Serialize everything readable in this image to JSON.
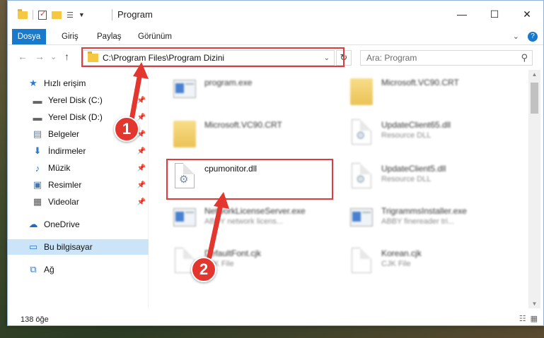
{
  "window": {
    "title": "Program",
    "controls": {
      "minimize": "—",
      "maximize": "☐",
      "close": "✕"
    }
  },
  "ribbon": {
    "tabs": [
      "Dosya",
      "Giriş",
      "Paylaş",
      "Görünüm"
    ],
    "accent_color": "#1979ca"
  },
  "navbar": {
    "back": "←",
    "forward": "→",
    "recent": "⌄",
    "up": "↑",
    "address": "C:\\Program Files\\Program Dizini",
    "search_placeholder": "Ara: Program"
  },
  "sidebar": {
    "items": [
      {
        "label": "Hızlı erişim",
        "icon": "star-icon",
        "pinned": false
      },
      {
        "label": "Yerel Disk (C:)",
        "icon": "drive-icon",
        "pinned": true
      },
      {
        "label": "Yerel Disk (D:)",
        "icon": "drive-icon",
        "pinned": true
      },
      {
        "label": "Belgeler",
        "icon": "documents-icon",
        "pinned": true
      },
      {
        "label": "İndirmeler",
        "icon": "download-icon",
        "pinned": true
      },
      {
        "label": "Müzik",
        "icon": "music-icon",
        "pinned": true
      },
      {
        "label": "Resimler",
        "icon": "pictures-icon",
        "pinned": true
      },
      {
        "label": "Videolar",
        "icon": "videos-icon",
        "pinned": true
      },
      {
        "label": "OneDrive",
        "icon": "cloud-icon",
        "pinned": false
      },
      {
        "label": "Bu bilgisayar",
        "icon": "computer-icon",
        "pinned": false,
        "selected": true
      },
      {
        "label": "Ağ",
        "icon": "network-icon",
        "pinned": false
      }
    ]
  },
  "files": [
    {
      "name": "program.exe",
      "desc": "",
      "icon": "exe-settings-icon"
    },
    {
      "name": "Microsoft.VC90.CRT",
      "desc": "",
      "icon": "folder-icon"
    },
    {
      "name": "Microsoft.VC90.CRT",
      "desc": "",
      "icon": "folder-icon"
    },
    {
      "name": "UpdateClient65.dll",
      "desc": "Resource DLL",
      "icon": "dll-icon"
    },
    {
      "name": "cpumonitor.dll",
      "desc": "",
      "icon": "dll-icon",
      "highlighted": true
    },
    {
      "name": "UpdateClient5.dll",
      "desc": "Resource DLL",
      "icon": "dll-icon"
    },
    {
      "name": "NetworkLicenseServer.exe",
      "desc": "ABBY network licens...",
      "icon": "exe-icon"
    },
    {
      "name": "TrigrammsInstaller.exe",
      "desc": "ABBY finereader tri...",
      "icon": "exe-icon"
    },
    {
      "name": "DefaultFont.cjk",
      "desc": "CJK File",
      "icon": "file-icon"
    },
    {
      "name": "Korean.cjk",
      "desc": "CJK File",
      "icon": "file-icon"
    }
  ],
  "status": {
    "count": "138 öğe"
  },
  "annotations": {
    "step1": "1",
    "step2": "2",
    "color": "#e2362f"
  }
}
